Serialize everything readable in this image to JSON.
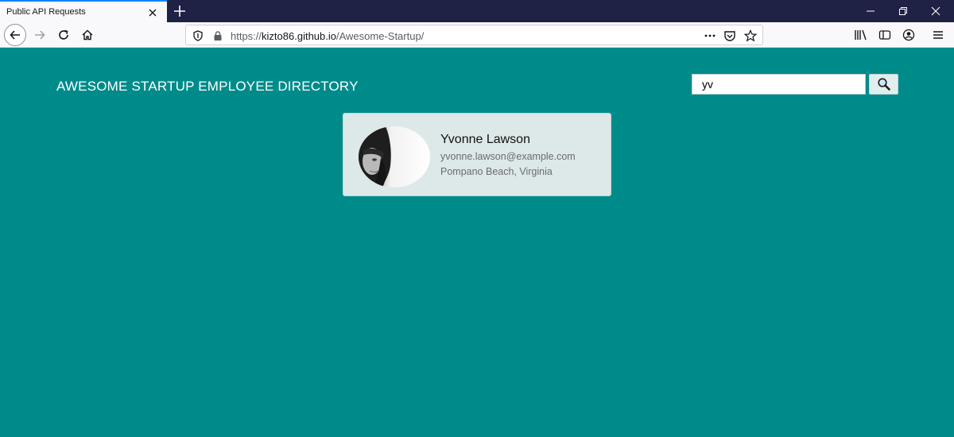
{
  "browser": {
    "tab_title": "Public API Requests",
    "url_prefix": "https://",
    "url_host": "kizto86.github.io",
    "url_path": "/Awesome-Startup/",
    "page_actions_icon": "more-horizontal-icon"
  },
  "header": {
    "title": "AWESOME STARTUP EMPLOYEE DIRECTORY"
  },
  "search": {
    "value": "yv",
    "button_icon": "magnifier-icon"
  },
  "employees": [
    {
      "name": "Yvonne Lawson",
      "email": "yvonne.lawson@example.com",
      "location": "Pompano Beach, Virginia"
    }
  ],
  "colors": {
    "page_background": "#008b8b",
    "card_background": "#dde8e8",
    "header_text": "#ffffff"
  }
}
